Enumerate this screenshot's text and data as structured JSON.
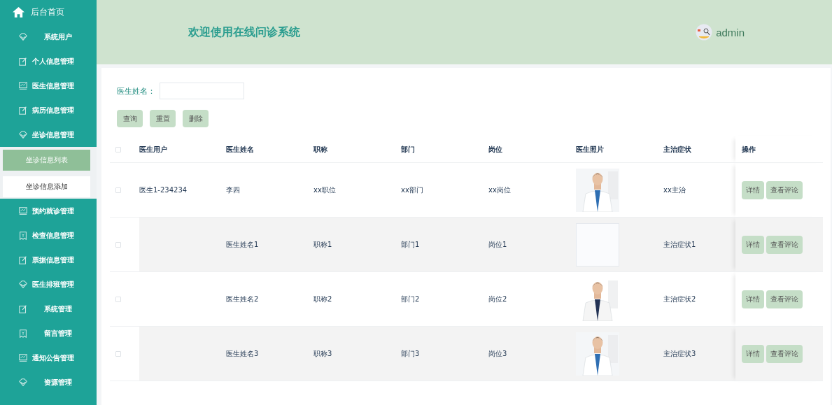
{
  "sidebar": {
    "home": "后台首页",
    "items": [
      {
        "label": "系统用户"
      },
      {
        "label": "个人信息管理"
      },
      {
        "label": "医生信息管理"
      },
      {
        "label": "病历信息管理"
      },
      {
        "label": "坐诊信息管理",
        "expanded": true,
        "children": [
          {
            "label": "坐诊信息列表",
            "selected": true
          },
          {
            "label": "坐诊信息添加",
            "selected": false
          }
        ]
      },
      {
        "label": "预约就诊管理"
      },
      {
        "label": "检查信息管理"
      },
      {
        "label": "票据信息管理"
      },
      {
        "label": "医生排班管理"
      },
      {
        "label": "系统管理"
      },
      {
        "label": "留言管理"
      },
      {
        "label": "通知公告管理"
      },
      {
        "label": "资源管理"
      }
    ]
  },
  "header": {
    "title": "欢迎使用在线问诊系统",
    "user": "admin"
  },
  "search": {
    "label": "医生姓名："
  },
  "buttons": [
    "查询",
    "重置",
    "删除"
  ],
  "table": {
    "header_checked": false,
    "columns": [
      "医生用户",
      "医生姓名",
      "职称",
      "部门",
      "岗位",
      "医生照片",
      "主治症状",
      "操作"
    ],
    "rows": [
      {
        "checked": false,
        "cells": [
          "医生1-234234",
          "李四",
          "xx职位",
          "xx部门",
          "xx岗位"
        ],
        "has_photo": true,
        "symptom": "xx主治",
        "actions": [
          "详情",
          "查看评论"
        ]
      },
      {
        "checked": false,
        "cells": [
          "",
          "医生姓名1",
          "职称1",
          "部门1",
          "岗位1"
        ],
        "has_photo": false,
        "symptom": "主治症状1",
        "actions": [
          "详情",
          "查看评论"
        ]
      },
      {
        "checked": false,
        "cells": [
          "",
          "医生姓名2",
          "职称2",
          "部门2",
          "岗位2"
        ],
        "has_photo": true,
        "symptom": "主治症状2",
        "actions": [
          "详情",
          "查看评论"
        ]
      },
      {
        "checked": false,
        "cells": [
          "",
          "医生姓名3",
          "职称3",
          "部门3",
          "岗位3"
        ],
        "has_photo": true,
        "symptom": "主治症状3",
        "actions": [
          "详情",
          "查看评论"
        ]
      }
    ]
  }
}
